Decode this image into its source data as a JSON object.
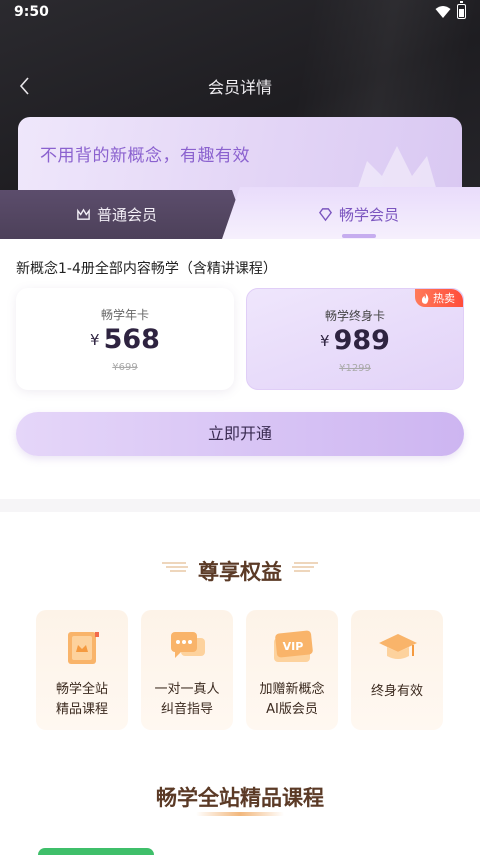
{
  "status_bar": {
    "time": "9:50"
  },
  "header": {
    "title": "会员详情"
  },
  "banner": {
    "text": "不用背的新概念，有趣有效"
  },
  "tabs": [
    {
      "label": "普通会员",
      "icon": "crown-outline-icon",
      "active": false
    },
    {
      "label": "畅学会员",
      "icon": "diamond-heart-icon",
      "active": true
    }
  ],
  "course": {
    "description": "新概念1-4册全部内容畅学（含精讲课程）"
  },
  "plans": [
    {
      "name": "畅学年卡",
      "currency": "¥",
      "price": "568",
      "original": "¥699",
      "selected": false
    },
    {
      "name": "畅学终身卡",
      "currency": "¥",
      "price": "989",
      "original": "¥1299",
      "selected": true,
      "badge": "热卖"
    }
  ],
  "cta": {
    "label": "立即开通"
  },
  "benefits": {
    "title": "尊享权益",
    "items": [
      {
        "line1": "畅学全站",
        "line2": "精品课程",
        "icon": "course-book-icon"
      },
      {
        "line1": "一对一真人",
        "line2": "纠音指导",
        "icon": "chat-bubble-icon"
      },
      {
        "line1": "加赠新概念",
        "line2": "AI版会员",
        "icon": "vip-card-icon",
        "icon_text": "VIP"
      },
      {
        "line1": "终身有效",
        "line2": "",
        "icon": "graduation-cap-icon"
      }
    ]
  },
  "courses_section": {
    "title": "畅学全站精品课程"
  },
  "colors": {
    "accent": "#8b62cf",
    "hot": "#ff4d3a",
    "gold": "#5b3a26"
  }
}
